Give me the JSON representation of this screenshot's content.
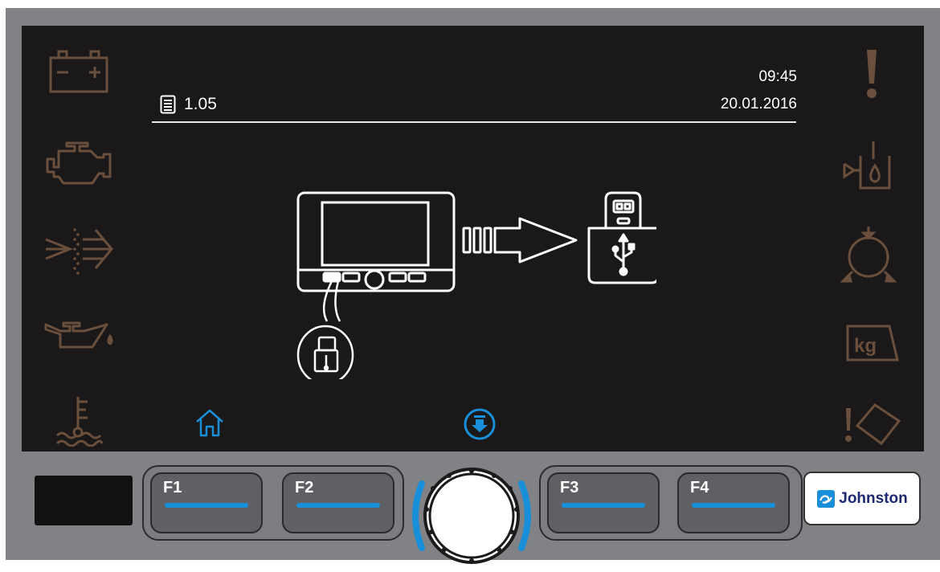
{
  "header": {
    "version": "1.05",
    "time": "09:45",
    "date": "20.01.2016"
  },
  "left_status_icons": [
    "battery-icon",
    "engine-icon",
    "fuel-filter-icon",
    "oil-can-icon",
    "coolant-temperature-icon"
  ],
  "right_status_icons": [
    "warning-exclamation-icon",
    "hydraulic-tank-icon",
    "pump-icon",
    "kg-weight-icon",
    "tilt-warning-icon"
  ],
  "illustration": {
    "name": "usb-export-illustration",
    "icons": [
      "display-unit-icon",
      "usb-stick-icon",
      "arrow-right-icon"
    ]
  },
  "bottom_nav": {
    "home": "home-icon",
    "download": "download-icon"
  },
  "function_keys": {
    "f1": "F1",
    "f2": "F2",
    "f3": "F3",
    "f4": "F4"
  },
  "brand": {
    "name": "Johnston"
  },
  "colors": {
    "screen_bg": "#1a1818",
    "status_icon": "#6b4f3d",
    "accent_blue": "#1a8fd9",
    "device_frame": "#808285"
  }
}
